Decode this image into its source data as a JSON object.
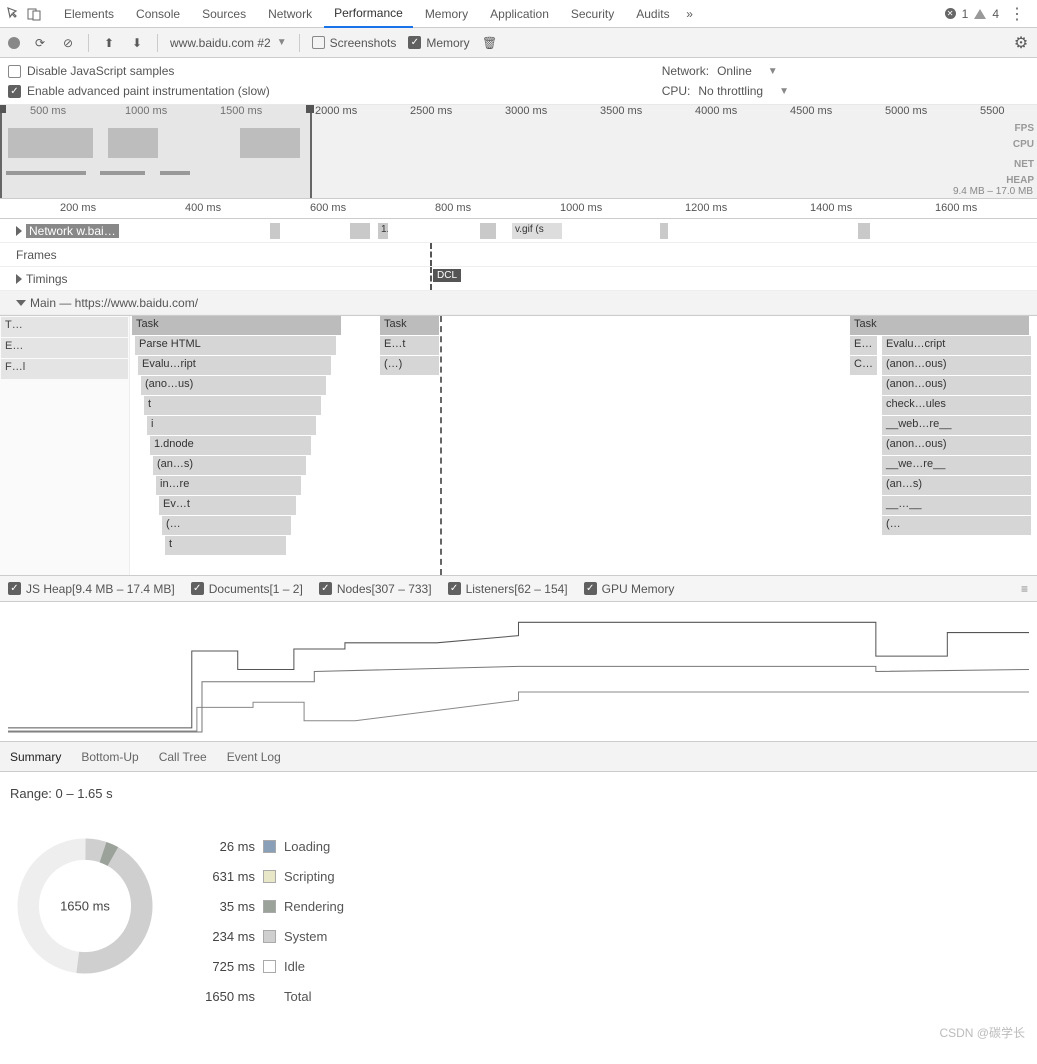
{
  "topbar": {
    "tabs": [
      "Elements",
      "Console",
      "Sources",
      "Network",
      "Performance",
      "Memory",
      "Application",
      "Security",
      "Audits"
    ],
    "active_tab": "Performance",
    "errors": "1",
    "warnings": "4"
  },
  "toolbar": {
    "url": "www.baidu.com #2",
    "screenshots_label": "Screenshots",
    "screenshots_checked": false,
    "memory_label": "Memory",
    "memory_checked": true
  },
  "options": {
    "disable_js": {
      "label": "Disable JavaScript samples",
      "checked": false
    },
    "adv_paint": {
      "label": "Enable advanced paint instrumentation (slow)",
      "checked": true
    },
    "network_label": "Network:",
    "network_value": "Online",
    "cpu_label": "CPU:",
    "cpu_value": "No throttling"
  },
  "overview": {
    "ticks": [
      "500 ms",
      "1000 ms",
      "1500 ms",
      "2000 ms",
      "2500 ms",
      "3000 ms",
      "3500 ms",
      "4000 ms",
      "4500 ms",
      "5000 ms",
      "5500"
    ],
    "lanes": [
      "FPS",
      "CPU",
      "NET",
      "HEAP"
    ],
    "mem_label": "9.4 MB – 17.0 MB"
  },
  "ruler": {
    "ticks": [
      "200 ms",
      "400 ms",
      "600 ms",
      "800 ms",
      "1000 ms",
      "1200 ms",
      "1400 ms",
      "1600 ms"
    ]
  },
  "tracks": {
    "network": "Network w.bai…",
    "network_item": "v.gif (s",
    "frames": "Frames",
    "timings": "Timings",
    "dcl": "DCL",
    "main": "Main — https://www.baidu.com/"
  },
  "flame": {
    "left_col": [
      "T…",
      "E…",
      "F…l"
    ],
    "col1": [
      "Task",
      "Parse HTML",
      "Evalu…ript",
      "(ano…us)",
      "t",
      "i",
      "1.dnode",
      "(an…s)",
      "in…re",
      "Ev…t",
      "(…",
      "t"
    ],
    "col2": [
      "Task",
      "E…t",
      "(…)"
    ],
    "col3_hdr": [
      "E…",
      "C…"
    ],
    "col3": [
      "Task",
      "Evalu…cript",
      "(anon…ous)",
      "(anon…ous)",
      "check…ules",
      "__web…re__",
      "(anon…ous)",
      "__we…re__",
      "(an…s)",
      "__…__",
      "(…"
    ]
  },
  "memory_toolbar": {
    "items": [
      "JS Heap[9.4 MB – 17.4 MB]",
      "Documents[1 – 2]",
      "Nodes[307 – 733]",
      "Listeners[62 – 154]",
      "GPU Memory"
    ]
  },
  "bottom_tabs": {
    "items": [
      "Summary",
      "Bottom-Up",
      "Call Tree",
      "Event Log"
    ],
    "active": "Summary"
  },
  "summary": {
    "range": "Range: 0 – 1.65 s",
    "total": "1650 ms",
    "rows": [
      {
        "ms": "26 ms",
        "label": "Loading",
        "color": "#8aa0b8"
      },
      {
        "ms": "631 ms",
        "label": "Scripting",
        "color": "#e8e8c8"
      },
      {
        "ms": "35 ms",
        "label": "Rendering",
        "color": "#9aa29a"
      },
      {
        "ms": "234 ms",
        "label": "System",
        "color": "#cfcfcf"
      },
      {
        "ms": "725 ms",
        "label": "Idle",
        "color": "#ffffff"
      },
      {
        "ms": "1650 ms",
        "label": "Total",
        "color": ""
      }
    ]
  },
  "chart_data": {
    "type": "pie",
    "title": "Time breakdown",
    "series": [
      {
        "name": "Loading",
        "value": 26
      },
      {
        "name": "Scripting",
        "value": 631
      },
      {
        "name": "Rendering",
        "value": 35
      },
      {
        "name": "System",
        "value": 234
      },
      {
        "name": "Idle",
        "value": 725
      }
    ],
    "total_ms": 1650
  },
  "watermark": "CSDN @碳学长"
}
